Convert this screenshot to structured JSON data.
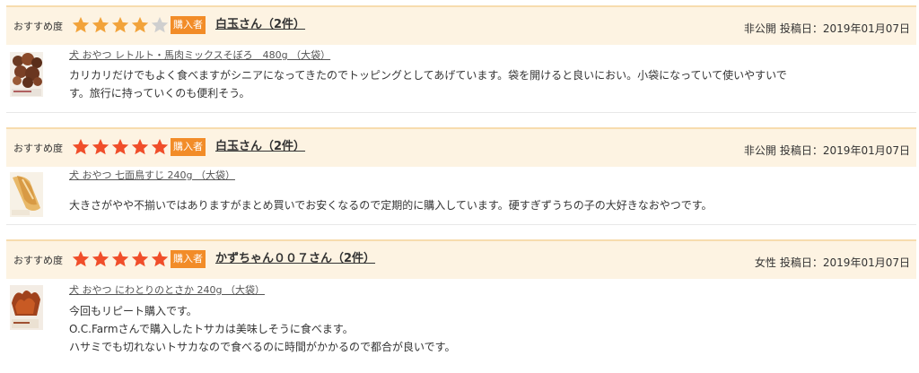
{
  "reviews": [
    {
      "rec_label": "おすすめ度",
      "rating": 4,
      "max_rating": 5,
      "buyer_badge": "購入者",
      "reviewer": "白玉さん（2件）",
      "gender": "非公開",
      "date_label": "投稿日：",
      "date": "2019年01月07日",
      "product": "犬 おやつ レトルト・馬肉ミックスそぼろ　480g （大袋）",
      "body": [
        "カリカリだけでもよく食べますがシニアになってきたのでトッピングとしてあげています。袋を開けると良いにおい。小袋になっていて使いやすいで",
        "す。旅行に持っていくのも便利そう。"
      ],
      "thumb": "dried-meat-bag-image"
    },
    {
      "rec_label": "おすすめ度",
      "rating": 5,
      "max_rating": 5,
      "buyer_badge": "購入者",
      "reviewer": "白玉さん（2件）",
      "gender": "非公開",
      "date_label": "投稿日：",
      "date": "2019年01月07日",
      "product": "犬 おやつ 七面鳥すじ 240g （大袋）",
      "body": [
        "大きさがやや不揃いではありますがまとめ買いでお安くなるので定期的に購入しています。硬すぎずうちの子の大好きなおやつです。"
      ],
      "thumb": "turkey-tendon-image"
    },
    {
      "rec_label": "おすすめ度",
      "rating": 5,
      "max_rating": 5,
      "buyer_badge": "購入者",
      "reviewer": "かずちゃん００７さん（2件）",
      "gender": "女性",
      "date_label": "投稿日：",
      "date": "2019年01月07日",
      "product": "犬 おやつ にわとりのとさか 240g （大袋）",
      "body": [
        "今回もリピート購入です。",
        "O.C.Farmさんで購入したトサカは美味しそうに食べます。",
        "ハサミでも切れないトサカなので食べるのに時間がかかるので都合が良いです。"
      ],
      "thumb": "chicken-comb-image"
    }
  ],
  "colors": {
    "header_bg": "#fdf3e2",
    "header_border": "#f7dcae",
    "star_on_4": "#f2a33a",
    "star_on_5": "#f04e2a",
    "star_off": "#cfcfcf",
    "badge": "#f28c28"
  }
}
